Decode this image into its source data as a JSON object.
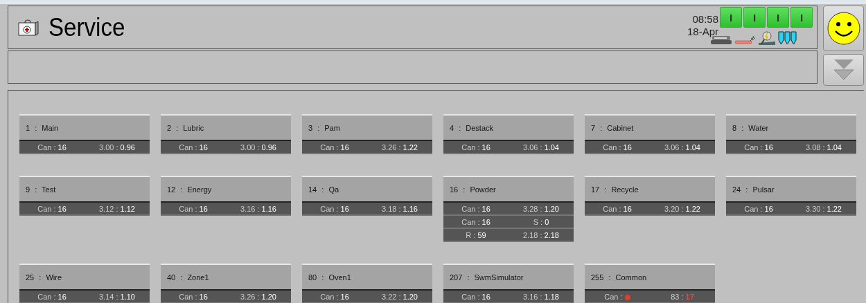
{
  "header": {
    "title": "Service",
    "time": "08:58",
    "date": "18-Apr",
    "indicators": [
      {
        "label": "I",
        "on": true
      },
      {
        "label": "I",
        "on": true
      },
      {
        "label": "I",
        "on": true
      },
      {
        "label": "I",
        "on": true
      }
    ]
  },
  "modules": [
    {
      "title": "1 : Main",
      "rows": [
        [
          {
            "label": "Can :",
            "value": "16",
            "alert": false
          },
          {
            "label": "3.00 :",
            "value": "0.96",
            "alert": false
          }
        ]
      ]
    },
    {
      "title": "2 : Lubric",
      "rows": [
        [
          {
            "label": "Can :",
            "value": "16",
            "alert": false
          },
          {
            "label": "3.00 :",
            "value": "0.96",
            "alert": false
          }
        ]
      ]
    },
    {
      "title": "3 : Pam",
      "rows": [
        [
          {
            "label": "Can :",
            "value": "16",
            "alert": false
          },
          {
            "label": "3.26 :",
            "value": "1.22",
            "alert": false
          }
        ]
      ]
    },
    {
      "title": "4 : Destack",
      "rows": [
        [
          {
            "label": "Can :",
            "value": "16",
            "alert": false
          },
          {
            "label": "3.06 :",
            "value": "1.04",
            "alert": false
          }
        ]
      ]
    },
    {
      "title": "7 : Cabinet",
      "rows": [
        [
          {
            "label": "Can :",
            "value": "16",
            "alert": false
          },
          {
            "label": "3.06 :",
            "value": "1.04",
            "alert": false
          }
        ]
      ]
    },
    {
      "title": "8 : Water",
      "rows": [
        [
          {
            "label": "Can :",
            "value": "16",
            "alert": false
          },
          {
            "label": "3.08 :",
            "value": "1.04",
            "alert": false
          }
        ]
      ]
    },
    {
      "title": "9 : Test",
      "rows": [
        [
          {
            "label": "Can :",
            "value": "16",
            "alert": false
          },
          {
            "label": "3.12 :",
            "value": "1.12",
            "alert": false
          }
        ]
      ]
    },
    {
      "title": "12 : Energy",
      "rows": [
        [
          {
            "label": "Can :",
            "value": "16",
            "alert": false
          },
          {
            "label": "3.16 :",
            "value": "1.16",
            "alert": false
          }
        ]
      ]
    },
    {
      "title": "14 : Qa",
      "rows": [
        [
          {
            "label": "Can :",
            "value": "16",
            "alert": false
          },
          {
            "label": "3.18 :",
            "value": "1.16",
            "alert": false
          }
        ]
      ]
    },
    {
      "title": "16 : Powder",
      "rows": [
        [
          {
            "label": "Can :",
            "value": "16",
            "alert": false
          },
          {
            "label": "3.28 :",
            "value": "1.20",
            "alert": false
          }
        ],
        [
          {
            "label": "Can :",
            "value": "16",
            "alert": false
          },
          {
            "label": "S :",
            "value": "0",
            "alert": false
          }
        ],
        [
          {
            "label": "R :",
            "value": "59",
            "alert": false
          },
          {
            "label": "2.18 :",
            "value": "2.18",
            "alert": false
          }
        ]
      ]
    },
    {
      "title": "17 : Recycle",
      "rows": [
        [
          {
            "label": "Can :",
            "value": "16",
            "alert": false
          },
          {
            "label": "3.20 :",
            "value": "1.22",
            "alert": false
          }
        ]
      ]
    },
    {
      "title": "24 : Pulsar",
      "rows": [
        [
          {
            "label": "Can :",
            "value": "16",
            "alert": false
          },
          {
            "label": "3.30 :",
            "value": "1.22",
            "alert": false
          }
        ]
      ]
    },
    {
      "title": "25 : Wire",
      "rows": [
        [
          {
            "label": "Can :",
            "value": "16",
            "alert": false
          },
          {
            "label": "3.14 :",
            "value": "1.10",
            "alert": false
          }
        ]
      ]
    },
    {
      "title": "40 : Zone1",
      "rows": [
        [
          {
            "label": "Can :",
            "value": "16",
            "alert": false
          },
          {
            "label": "3.26 :",
            "value": "1.20",
            "alert": false
          }
        ]
      ]
    },
    {
      "title": "80 : Oven1",
      "rows": [
        [
          {
            "label": "Can :",
            "value": "16",
            "alert": false
          },
          {
            "label": "3.22 :",
            "value": "1.20",
            "alert": false
          }
        ]
      ]
    },
    {
      "title": "207 : SwmSimulator",
      "rows": [
        [
          {
            "label": "Can :",
            "value": "16",
            "alert": false
          },
          {
            "label": "3.16 :",
            "value": "1.18",
            "alert": false
          }
        ]
      ]
    },
    {
      "title": "255 : Common",
      "rows": [
        [
          {
            "label": "Can :",
            "kind": "dot",
            "color": "#e0402a"
          },
          {
            "label": "83 :",
            "value": "17",
            "alert": true
          }
        ]
      ]
    }
  ]
}
